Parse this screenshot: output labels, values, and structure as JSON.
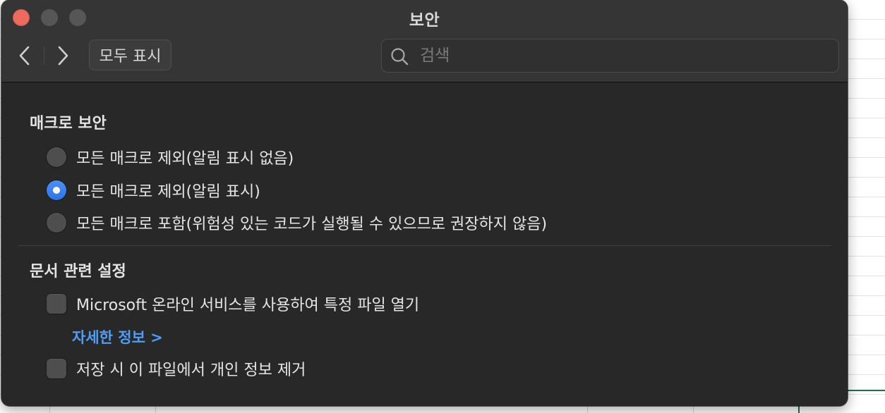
{
  "window": {
    "title": "보안"
  },
  "toolbar": {
    "show_all_label": "모두 표시",
    "search_placeholder": "검색",
    "back_icon": "chevron-left-icon",
    "forward_icon": "chevron-right-icon"
  },
  "macro_security": {
    "title": "매크로 보안",
    "options": [
      {
        "label": "모든 매크로 제외(알림 표시 없음)",
        "selected": false
      },
      {
        "label": "모든 매크로 제외(알림 표시)",
        "selected": true
      },
      {
        "label": "모든 매크로 포함(위험성 있는 코드가 실행될 수 있으므로 권장하지 않음)",
        "selected": false
      }
    ]
  },
  "document_settings": {
    "title": "문서 관련 설정",
    "online_services": {
      "label": "Microsoft 온라인 서비스를 사용하여 특정 파일 열기",
      "checked": false
    },
    "more_info_link": "자세한 정보 >",
    "remove_personal_info": {
      "label": "저장 시 이 파일에서 개인 정보 제거",
      "checked": false
    }
  },
  "colors": {
    "accent": "#3b82f6",
    "link": "#4e9ef8",
    "close_button": "#ed6a5e"
  }
}
